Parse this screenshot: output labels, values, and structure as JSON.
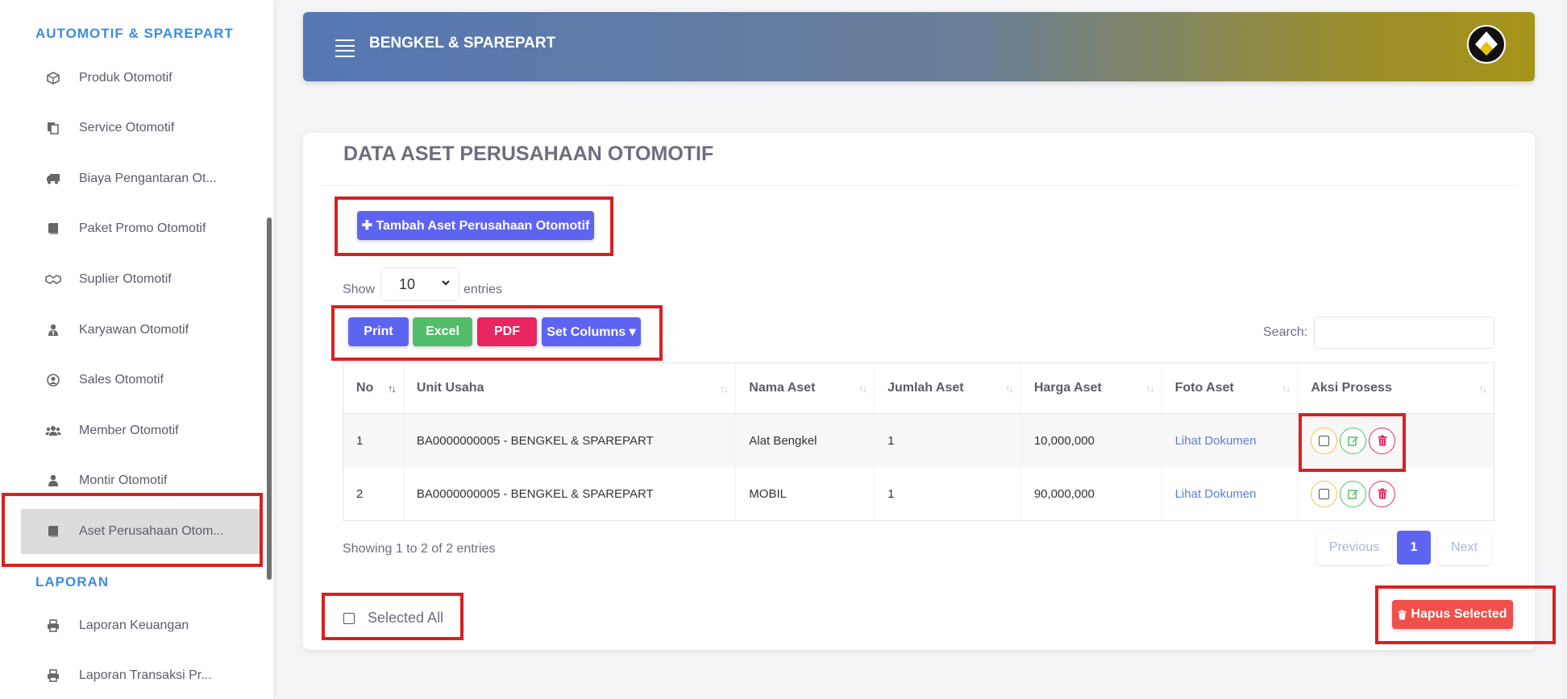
{
  "sidebar": {
    "heading_automotif": "AUTOMOTIF & SPAREPART",
    "heading_laporan": "LAPORAN",
    "items": [
      {
        "label": "Produk Otomotif",
        "icon": "box-icon"
      },
      {
        "label": "Service Otomotif",
        "icon": "copy-icon"
      },
      {
        "label": "Biaya Pengantaran Ot...",
        "icon": "truck-icon"
      },
      {
        "label": "Paket Promo Otomotif",
        "icon": "book-icon"
      },
      {
        "label": "Suplier Otomotif",
        "icon": "handshake-icon"
      },
      {
        "label": "Karyawan Otomotif",
        "icon": "user-tie-icon"
      },
      {
        "label": "Sales Otomotif",
        "icon": "user-circle-icon"
      },
      {
        "label": "Member Otomotif",
        "icon": "users-icon"
      },
      {
        "label": "Montir Otomotif",
        "icon": "user-icon"
      },
      {
        "label": "Aset Perusahaan Otom...",
        "icon": "book-icon",
        "active": true
      }
    ],
    "laporan_items": [
      {
        "label": "Laporan Keuangan",
        "icon": "print-icon"
      },
      {
        "label": "Laporan Transaksi Pr...",
        "icon": "print-icon"
      }
    ]
  },
  "header": {
    "title": "BENGKEL & SPAREPART"
  },
  "card": {
    "title": "DATA ASET PERUSAHAAN OTOMOTIF",
    "add_button": "✚ Tambah Aset Perusahaan Otomotif",
    "show_label": "Show",
    "entries_value": "10",
    "entries_label": "entries",
    "export": {
      "print": "Print",
      "excel": "Excel",
      "pdf": "PDF",
      "set_columns": "Set Columns ▾"
    },
    "search_label": "Search:",
    "columns": [
      "No",
      "Unit Usaha",
      "Nama Aset",
      "Jumlah Aset",
      "Harga Aset",
      "Foto Aset",
      "Aksi Prosess"
    ],
    "rows": [
      {
        "no": "1",
        "unit": "BA0000000005 - BENGKEL & SPAREPART",
        "nama": "Alat Bengkel",
        "jumlah": "1",
        "harga": "10,000,000",
        "foto": "Lihat Dokumen"
      },
      {
        "no": "2",
        "unit": "BA0000000005 - BENGKEL & SPAREPART",
        "nama": "MOBIL",
        "jumlah": "1",
        "harga": "90,000,000",
        "foto": "Lihat Dokumen"
      }
    ],
    "info": "Showing 1 to 2 of 2 entries",
    "pagination": {
      "previous": "Previous",
      "current": "1",
      "next": "Next"
    },
    "selected_all": "Selected All",
    "hapus_selected": "Hapus Selected"
  },
  "colors": {
    "accent": "#5d64f2",
    "success": "#52be6c",
    "danger": "#e8265f",
    "highlight": "#d9201f",
    "sidebar_heading": "#3b8de0"
  }
}
